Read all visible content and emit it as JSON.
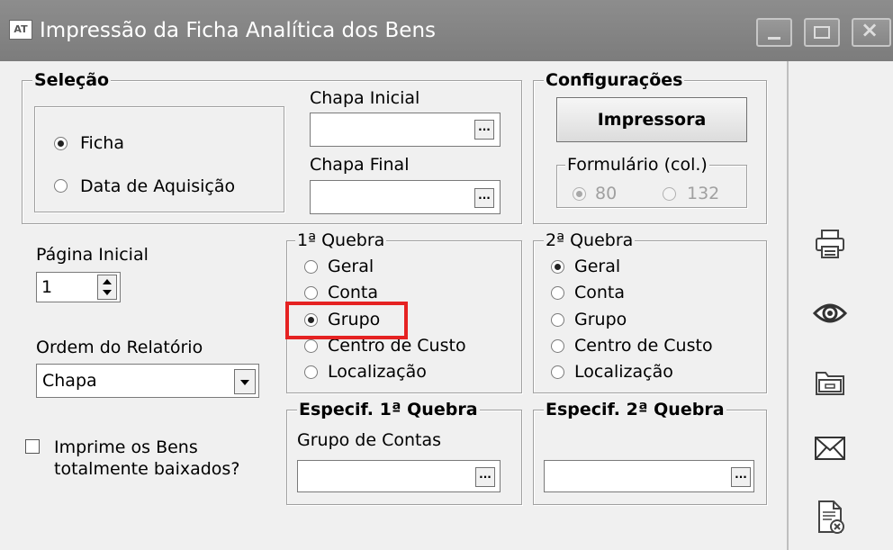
{
  "window": {
    "app_icon_text": "AT",
    "title": "Impressão da Ficha Analítica dos Bens"
  },
  "selecao": {
    "title": "Seleção",
    "options": [
      {
        "label": "Ficha",
        "selected": true
      },
      {
        "label": "Data de Aquisição",
        "selected": false
      }
    ],
    "chapa_inicial_label": "Chapa Inicial",
    "chapa_inicial_value": "",
    "chapa_final_label": "Chapa Final",
    "chapa_final_value": "",
    "lookup_button": "..."
  },
  "configuracoes": {
    "title": "Configurações",
    "printer_button": "Impressora",
    "formulario_title": "Formulário (col.)",
    "formulario_options": [
      {
        "label": "80",
        "selected": true,
        "enabled": false
      },
      {
        "label": "132",
        "selected": false,
        "enabled": false
      }
    ]
  },
  "pagina_inicial": {
    "label": "Página Inicial",
    "value": "1"
  },
  "ordem_relatorio": {
    "label": "Ordem do Relatório",
    "selected": "Chapa"
  },
  "quebra1": {
    "title": "1ª Quebra",
    "options": [
      "Geral",
      "Conta",
      "Grupo",
      "Centro de Custo",
      "Localização"
    ],
    "selected": "Grupo"
  },
  "quebra2": {
    "title": "2ª Quebra",
    "options": [
      "Geral",
      "Conta",
      "Grupo",
      "Centro de Custo",
      "Localização"
    ],
    "selected": "Geral"
  },
  "especif1": {
    "title": "Especif. 1ª Quebra",
    "field_label": "Grupo de Contas",
    "value": ""
  },
  "especif2": {
    "title": "Especif. 2ª Quebra",
    "value": ""
  },
  "imprime_baixados": {
    "label_line1": "Imprime os Bens",
    "label_line2": "totalmente baixados?",
    "checked": false
  },
  "toolbar": [
    "printer-icon",
    "preview-eye-icon",
    "open-folder-icon",
    "email-envelope-icon",
    "cancel-document-icon"
  ],
  "colors": {
    "titlebar": "#858585",
    "highlight": "#e52222",
    "background": "#f0f0f0"
  }
}
